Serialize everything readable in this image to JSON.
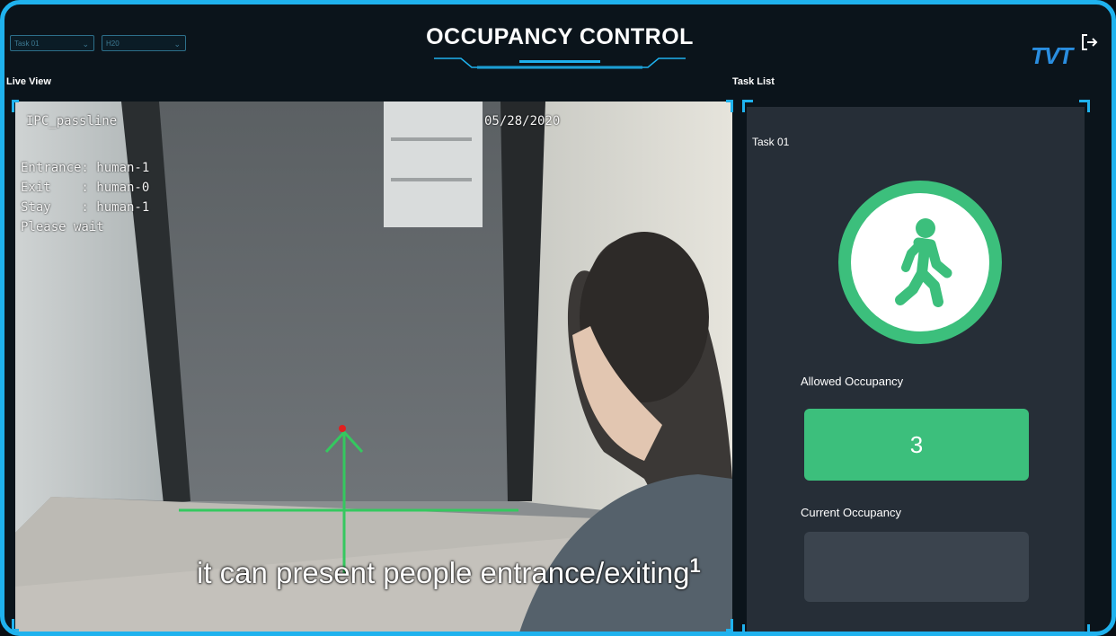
{
  "header": {
    "title": "OCCUPANCY CONTROL",
    "task_select": "Task 01",
    "second_select": "H20",
    "brand": "TVT"
  },
  "live_view": {
    "label": "Live View",
    "osd_name": "IPC_passline",
    "osd_datetime": "05/28/2020",
    "osd_entrance": "Entrance: human-1",
    "osd_exit": "Exit    : human-0",
    "osd_stay": "Stay    : human-1",
    "osd_wait": "Please wait",
    "caption": "it can present people entrance/exiting",
    "caption_mark": "1"
  },
  "task_list": {
    "label": "Task List",
    "task_name": "Task 01",
    "status_icon": "walking-person-icon",
    "allowed_label": "Allowed Occupancy",
    "allowed_value": "3",
    "current_label": "Current Occupancy"
  },
  "colors": {
    "accent": "#1fb2ee",
    "ok_green": "#3cbf7c",
    "panel_bg": "#262e37",
    "app_bg": "#0b141b"
  }
}
